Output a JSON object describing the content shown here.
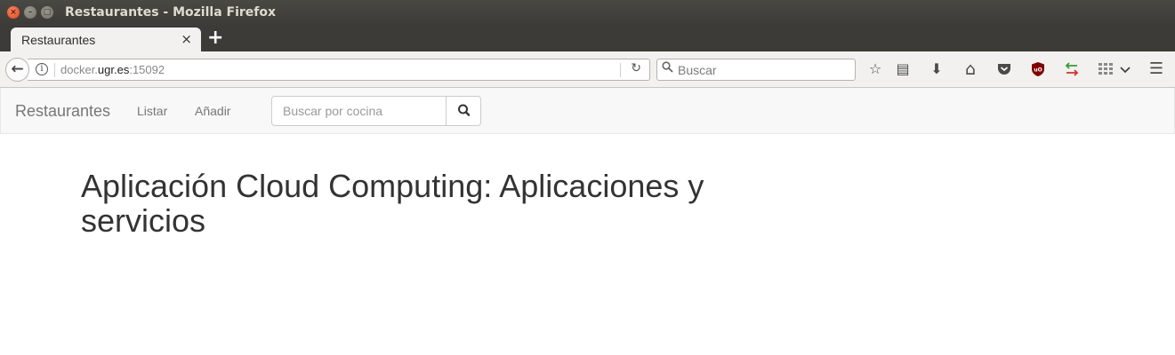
{
  "window": {
    "title": "Restaurantes - Mozilla Firefox",
    "close_glyph": "×",
    "min_glyph": "–",
    "max_glyph": "□"
  },
  "tabs": [
    {
      "label": "Restaurantes",
      "active": true,
      "close_glyph": "×"
    }
  ],
  "new_tab_glyph": "+",
  "toolbar": {
    "back_glyph": "←",
    "info_glyph": "i",
    "url": {
      "prefix": "docker.",
      "host": "ugr.es",
      "port": ":15092"
    },
    "reload_glyph": "↻",
    "search_placeholder": "Buscar",
    "search_glyph": "⚲",
    "icons": [
      {
        "name": "bookmark-star-icon",
        "glyph": "☆"
      },
      {
        "name": "reading-list-icon",
        "glyph": "▤"
      },
      {
        "name": "downloads-icon",
        "glyph": "⬇"
      },
      {
        "name": "home-icon",
        "glyph": "⌂"
      },
      {
        "name": "pocket-icon",
        "glyph": "◡"
      },
      {
        "name": "ublock-icon",
        "glyph": "uO"
      },
      {
        "name": "sync-arrows-icon",
        "glyph": "⇆"
      },
      {
        "name": "apps-grid-icon",
        "glyph": "▦"
      },
      {
        "name": "overflow-chevron-icon",
        "glyph": "⌄"
      },
      {
        "name": "hamburger-menu-icon",
        "glyph": "☰"
      }
    ],
    "colors": {
      "ublock": "#800000",
      "sync_green": "#3a9c3a",
      "sync_red": "#d0352b"
    }
  },
  "site_nav": {
    "brand": "Restaurantes",
    "links": [
      "Listar",
      "Añadir"
    ],
    "search_placeholder": "Buscar por cocina"
  },
  "main": {
    "heading": "Aplicación Cloud Computing: Aplicaciones y servicios"
  }
}
